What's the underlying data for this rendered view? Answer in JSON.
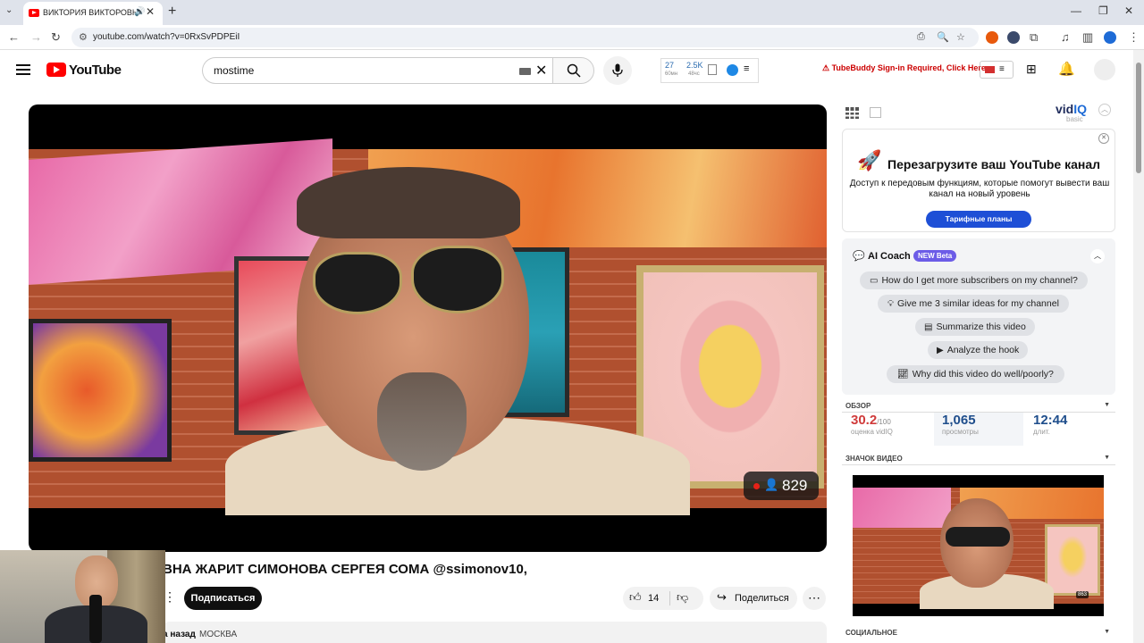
{
  "browser": {
    "tab_title": "ВИКТОРИЯ ВИКТОРОВНА",
    "url": "youtube.com/watch?v=0RxSvPDPEiI"
  },
  "youtube": {
    "logo_text": "YouTube",
    "search_query": "mostime",
    "stats_widget": {
      "count_1": "27",
      "count_1_sub": "60мн",
      "count_2": "2.5K",
      "count_2_sub": "48чс"
    },
    "tubebuddy_warning": "TubeBuddy Sign-in Required, Click Here"
  },
  "player": {
    "viewer_count": "829"
  },
  "video": {
    "title": "ВНА ЖАРИТ СИМОНОВА СЕРГЕЯ СОМА @ssimonov10,",
    "subscribe_label": "Подписаться",
    "like_count": "14",
    "share_label": "Поделиться",
    "published_ago": "а назад",
    "location": "МОСКВА"
  },
  "vidiq": {
    "logo_part1": "vid",
    "logo_part2": "IQ",
    "tier": "basic",
    "promo": {
      "title": "Перезагрузите ваш YouTube канал",
      "body": "Доступ к передовым функциям, которые помогут вывести ваш канал на новый уровень",
      "cta": "Тарифные планы"
    },
    "coach": {
      "title": "AI Coach",
      "badge": "NEW Beta",
      "prompts": [
        "How do I get more subscribers on my channel?",
        "Give me 3 similar ideas for my channel",
        "Summarize this video",
        "Analyze the hook",
        "Why did this video do well/poorly?"
      ]
    },
    "overview": {
      "header": "ОБЗОР",
      "score_value": "30.2",
      "score_max": "/100",
      "score_label": "оценка vidIQ",
      "views_value": "1,065",
      "views_label": "просмотры",
      "duration_value": "12:44",
      "duration_label": "длит."
    },
    "thumbnail_header": "ЗНАЧОК ВИДЕО",
    "thumbnail_badge": "863",
    "social_header": "СОЦИАЛЬНОЕ"
  },
  "colors": {
    "youtube_red": "#ff0000",
    "vidiq_blue": "#1e4fd6",
    "new_badge": "#6c5ce7",
    "score_red": "#d03b3b"
  }
}
